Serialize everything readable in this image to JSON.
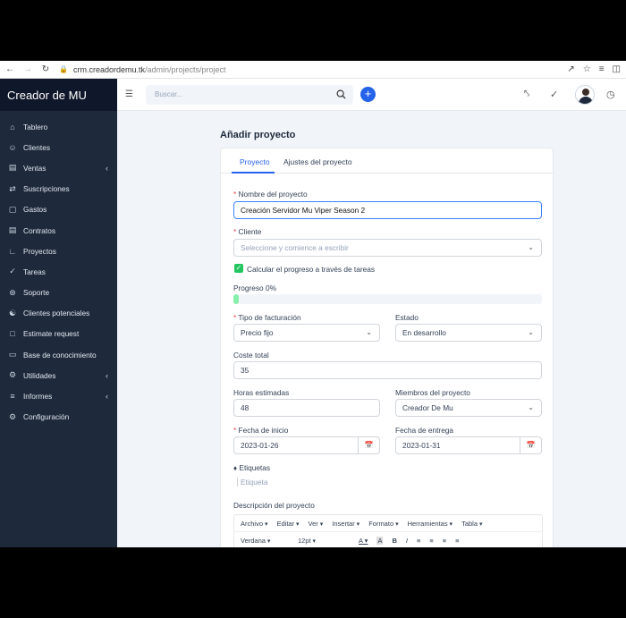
{
  "browser": {
    "url_host": "crm.creadordemu.tk",
    "url_path": "/admin/projects/project"
  },
  "sidebar": {
    "brand": "Creador de MU",
    "items": [
      {
        "label": "Tablero",
        "icon": "home-icon"
      },
      {
        "label": "Clientes",
        "icon": "user-icon"
      },
      {
        "label": "Ventas",
        "icon": "receipt-icon",
        "caret": true
      },
      {
        "label": "Suscripciones",
        "icon": "refresh-icon"
      },
      {
        "label": "Gastos",
        "icon": "file-icon"
      },
      {
        "label": "Contratos",
        "icon": "contract-icon"
      },
      {
        "label": "Proyectos",
        "icon": "chart-icon"
      },
      {
        "label": "Tareas",
        "icon": "check-circle-icon"
      },
      {
        "label": "Soporte",
        "icon": "lifebuoy-icon"
      },
      {
        "label": "Clientes potenciales",
        "icon": "leads-icon"
      },
      {
        "label": "Estimate request",
        "icon": "document-icon"
      },
      {
        "label": "Base de conocimiento",
        "icon": "folder-icon"
      },
      {
        "label": "Utilidades",
        "icon": "cogs-icon",
        "caret": true
      },
      {
        "label": "Informes",
        "icon": "bar-chart-icon",
        "caret": true
      },
      {
        "label": "Configuración",
        "icon": "gear-icon"
      }
    ]
  },
  "topbar": {
    "search_placeholder": "Buscar..."
  },
  "page": {
    "title": "Añadir proyecto",
    "tabs": [
      "Proyecto",
      "Ajustes del proyecto"
    ]
  },
  "form": {
    "name_label": "Nombre del proyecto",
    "name_value": "Creación Servidor Mu Viper Season 2",
    "client_label": "Cliente",
    "client_placeholder": "Seleccione y comience a escribir",
    "progress_check_label": "Calcular el progreso a través de tareas",
    "progress_label": "Progreso 0%",
    "progress_value": 0,
    "billing_label": "Tipo de facturación",
    "billing_value": "Precio fijo",
    "status_label": "Estado",
    "status_value": "En desarrollo",
    "cost_label": "Coste total",
    "cost_value": "35",
    "hours_label": "Horas estimadas",
    "hours_value": "48",
    "members_label": "Miembros del proyecto",
    "members_value": "Creador De Mu",
    "start_label": "Fecha de inicio",
    "start_value": "2023-01-26",
    "due_label": "Fecha de entrega",
    "due_value": "2023-01-31",
    "tags_label": "Etiquetas",
    "tags_placeholder": "Etiqueta",
    "desc_label": "Descripción del proyecto"
  },
  "editor": {
    "menus": [
      "Archivo",
      "Editar",
      "Ver",
      "Insertar",
      "Formato",
      "Herramientas",
      "Tabla"
    ],
    "font": "Verdana",
    "size": "12pt"
  }
}
